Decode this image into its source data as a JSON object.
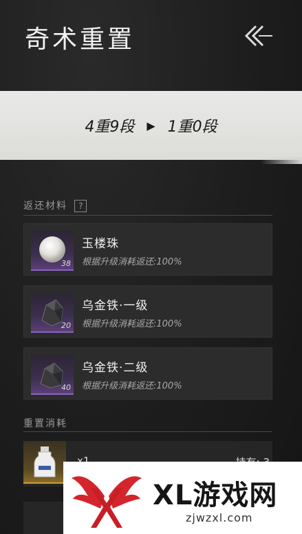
{
  "header": {
    "title": "奇术重置",
    "back_icon": "back-chevron-icon"
  },
  "level": {
    "from": "4重9段",
    "arrow": "▶",
    "to": "1重0段"
  },
  "returns": {
    "label": "返还材料",
    "help": "?",
    "items": [
      {
        "name": "玉楼珠",
        "count": "38",
        "desc": "根据升级消耗返还:100%",
        "icon": "pearl-icon"
      },
      {
        "name": "乌金铁·一级",
        "count": "20",
        "desc": "根据升级消耗返还:100%",
        "icon": "ore-icon"
      },
      {
        "name": "乌金铁·二级",
        "count": "40",
        "desc": "根据升级消耗返还:100%",
        "icon": "ore-icon"
      }
    ]
  },
  "cost": {
    "label": "重置消耗",
    "qty": "x1",
    "owned": "持有: 3",
    "icon": "bottle-icon"
  },
  "watermark": {
    "text": "XL游戏网",
    "url": "zjwzxl.com"
  },
  "colors": {
    "rarity_purple": "#8a62c0",
    "rarity_gold": "#c9a040",
    "banner": "#e4e4e2"
  }
}
